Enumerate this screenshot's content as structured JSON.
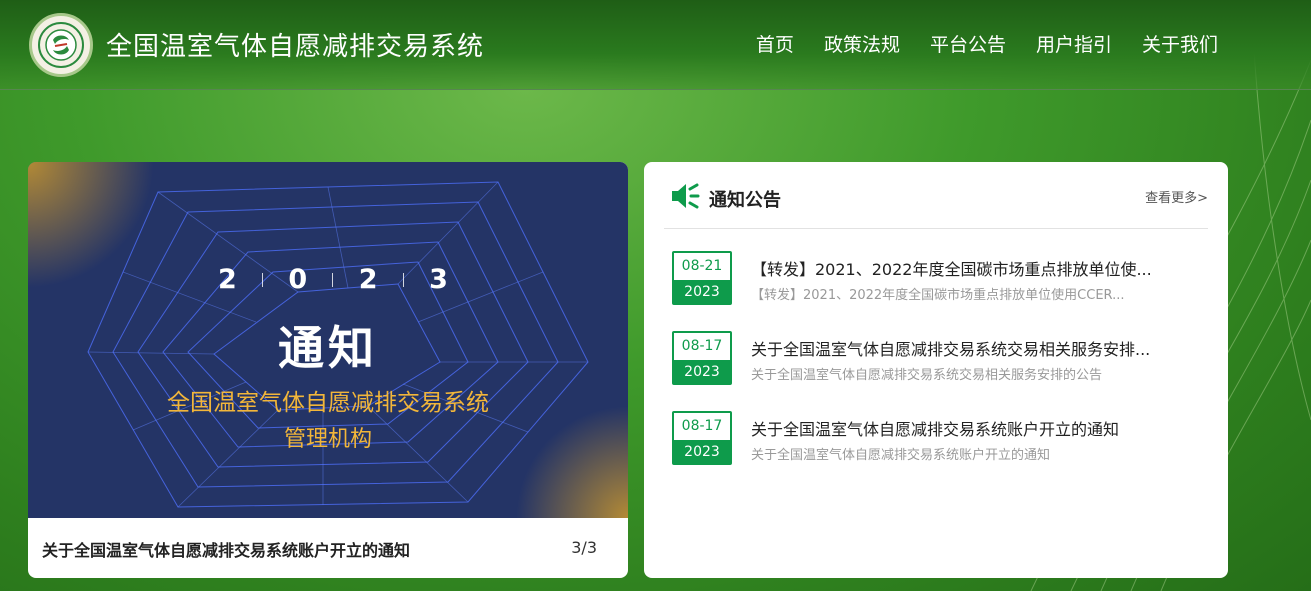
{
  "header": {
    "site_title": "全国温室气体自愿减排交易系统",
    "nav": [
      "首页",
      "政策法规",
      "平台公告",
      "用户指引",
      "关于我们"
    ]
  },
  "carousel": {
    "banner": {
      "year_digits": [
        "2",
        "0",
        "2",
        "3"
      ],
      "title": "通知",
      "subtitle_line1": "全国温室气体自愿减排交易系统",
      "subtitle_line2": "管理机构"
    },
    "caption": "关于全国温室气体自愿减排交易系统账户开立的通知",
    "counter": "3/3"
  },
  "notices": {
    "title": "通知公告",
    "more": "查看更多>",
    "items": [
      {
        "date": "08-21",
        "year": "2023",
        "title": "【转发】2021、2022年度全国碳市场重点排放单位使...",
        "desc": "【转发】2021、2022年度全国碳市场重点排放单位使用CCER..."
      },
      {
        "date": "08-17",
        "year": "2023",
        "title": "关于全国温室气体自愿减排交易系统交易相关服务安排...",
        "desc": "关于全国温室气体自愿减排交易系统交易相关服务安排的公告"
      },
      {
        "date": "08-17",
        "year": "2023",
        "title": "关于全国温室气体自愿减排交易系统账户开立的通知",
        "desc": "关于全国温室气体自愿减排交易系统账户开立的通知"
      }
    ]
  },
  "colors": {
    "accent_green": "#0e9b4b",
    "banner_bg": "#243466",
    "banner_gold": "#f2b63a"
  },
  "icons": [
    "logo-seal",
    "speaker-icon",
    "chevron-right-icon"
  ]
}
